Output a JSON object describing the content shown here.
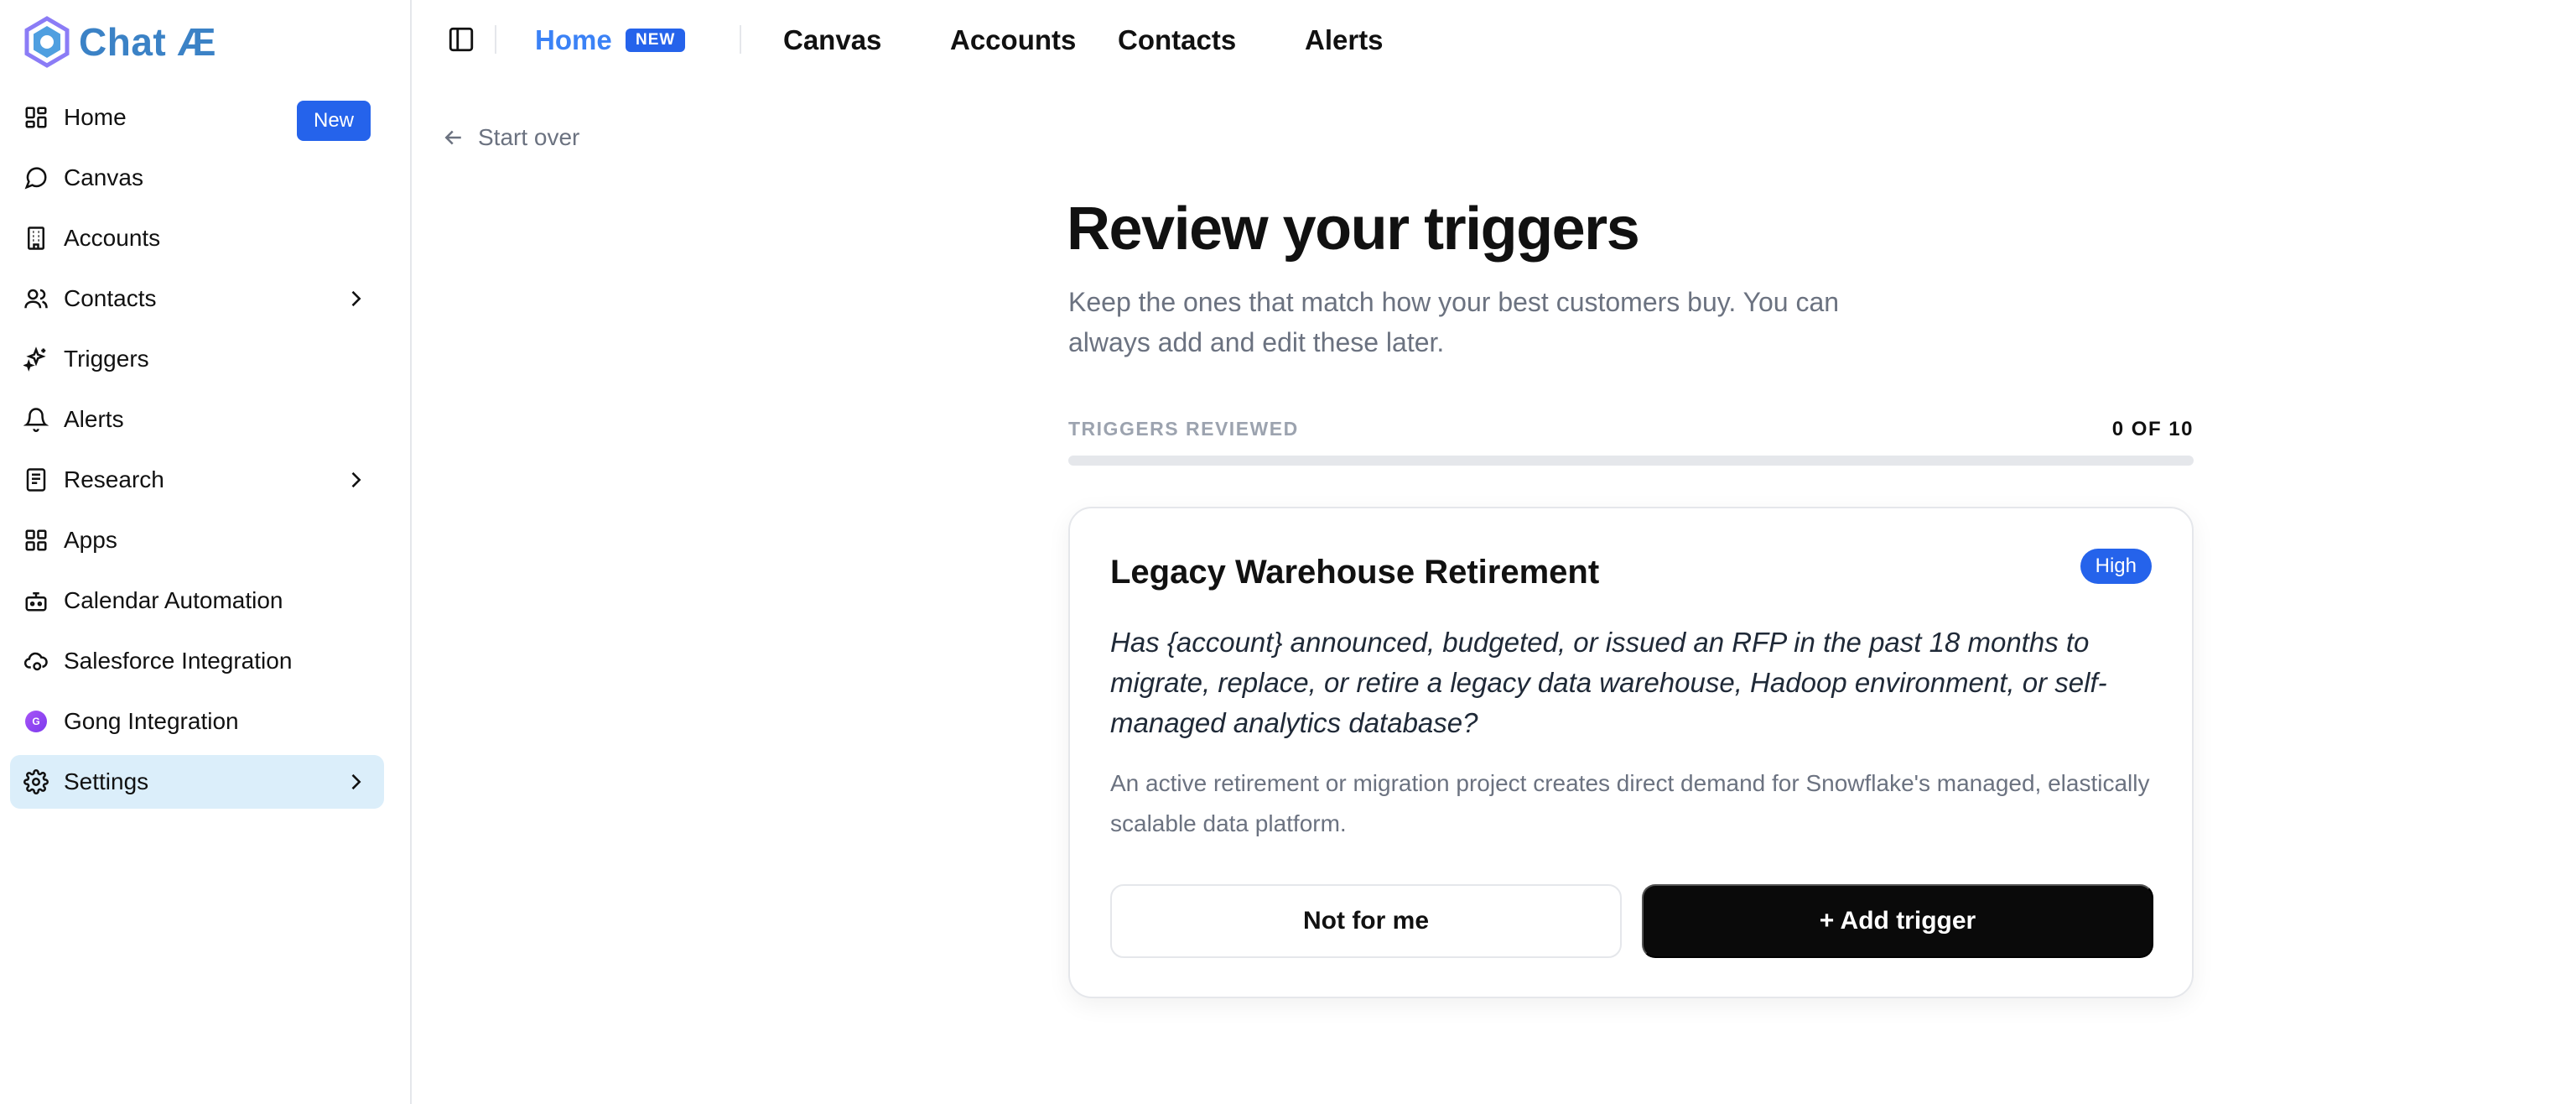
{
  "app": {
    "logo_text": "Chat Æ"
  },
  "sidebar": {
    "items": [
      {
        "label": "Home",
        "badge": "New"
      },
      {
        "label": "Canvas"
      },
      {
        "label": "Accounts"
      },
      {
        "label": "Contacts"
      },
      {
        "label": "Triggers"
      },
      {
        "label": "Alerts"
      },
      {
        "label": "Research"
      },
      {
        "label": "Apps"
      },
      {
        "label": "Calendar Automation"
      },
      {
        "label": "Salesforce Integration"
      },
      {
        "label": "Gong Integration",
        "icon_letter": "G"
      },
      {
        "label": "Settings"
      }
    ]
  },
  "topnav": {
    "tabs": [
      {
        "label": "Home",
        "badge": "NEW"
      },
      {
        "label": "Canvas"
      },
      {
        "label": "Accounts"
      },
      {
        "label": "Contacts"
      },
      {
        "label": "Alerts"
      }
    ]
  },
  "main": {
    "back_label": "Start over",
    "title": "Review your triggers",
    "subtitle": "Keep the ones that match how your best customers buy. You can always add and edit these later.",
    "progress": {
      "label": "TRIGGERS REVIEWED",
      "count_text": "0 OF 10",
      "reviewed": 0,
      "total": 10
    },
    "card": {
      "title": "Legacy Warehouse Retirement",
      "priority": "High",
      "question": "Has {account} announced, budgeted, or issued an RFP in the past 18 months to migrate, replace, or retire a legacy data warehouse, Hadoop environment, or self-managed analytics database?",
      "rationale": "An active retirement or migration project creates direct demand for Snowflake's managed, elastically scalable data platform.",
      "reject_label": "Not for me",
      "accept_label": "+ Add trigger"
    }
  },
  "colors": {
    "accent": "#2563eb",
    "active_tab": "#3b82f6",
    "active_nav_bg": "#dbeefa",
    "primary_button": "#0a0a0a"
  }
}
